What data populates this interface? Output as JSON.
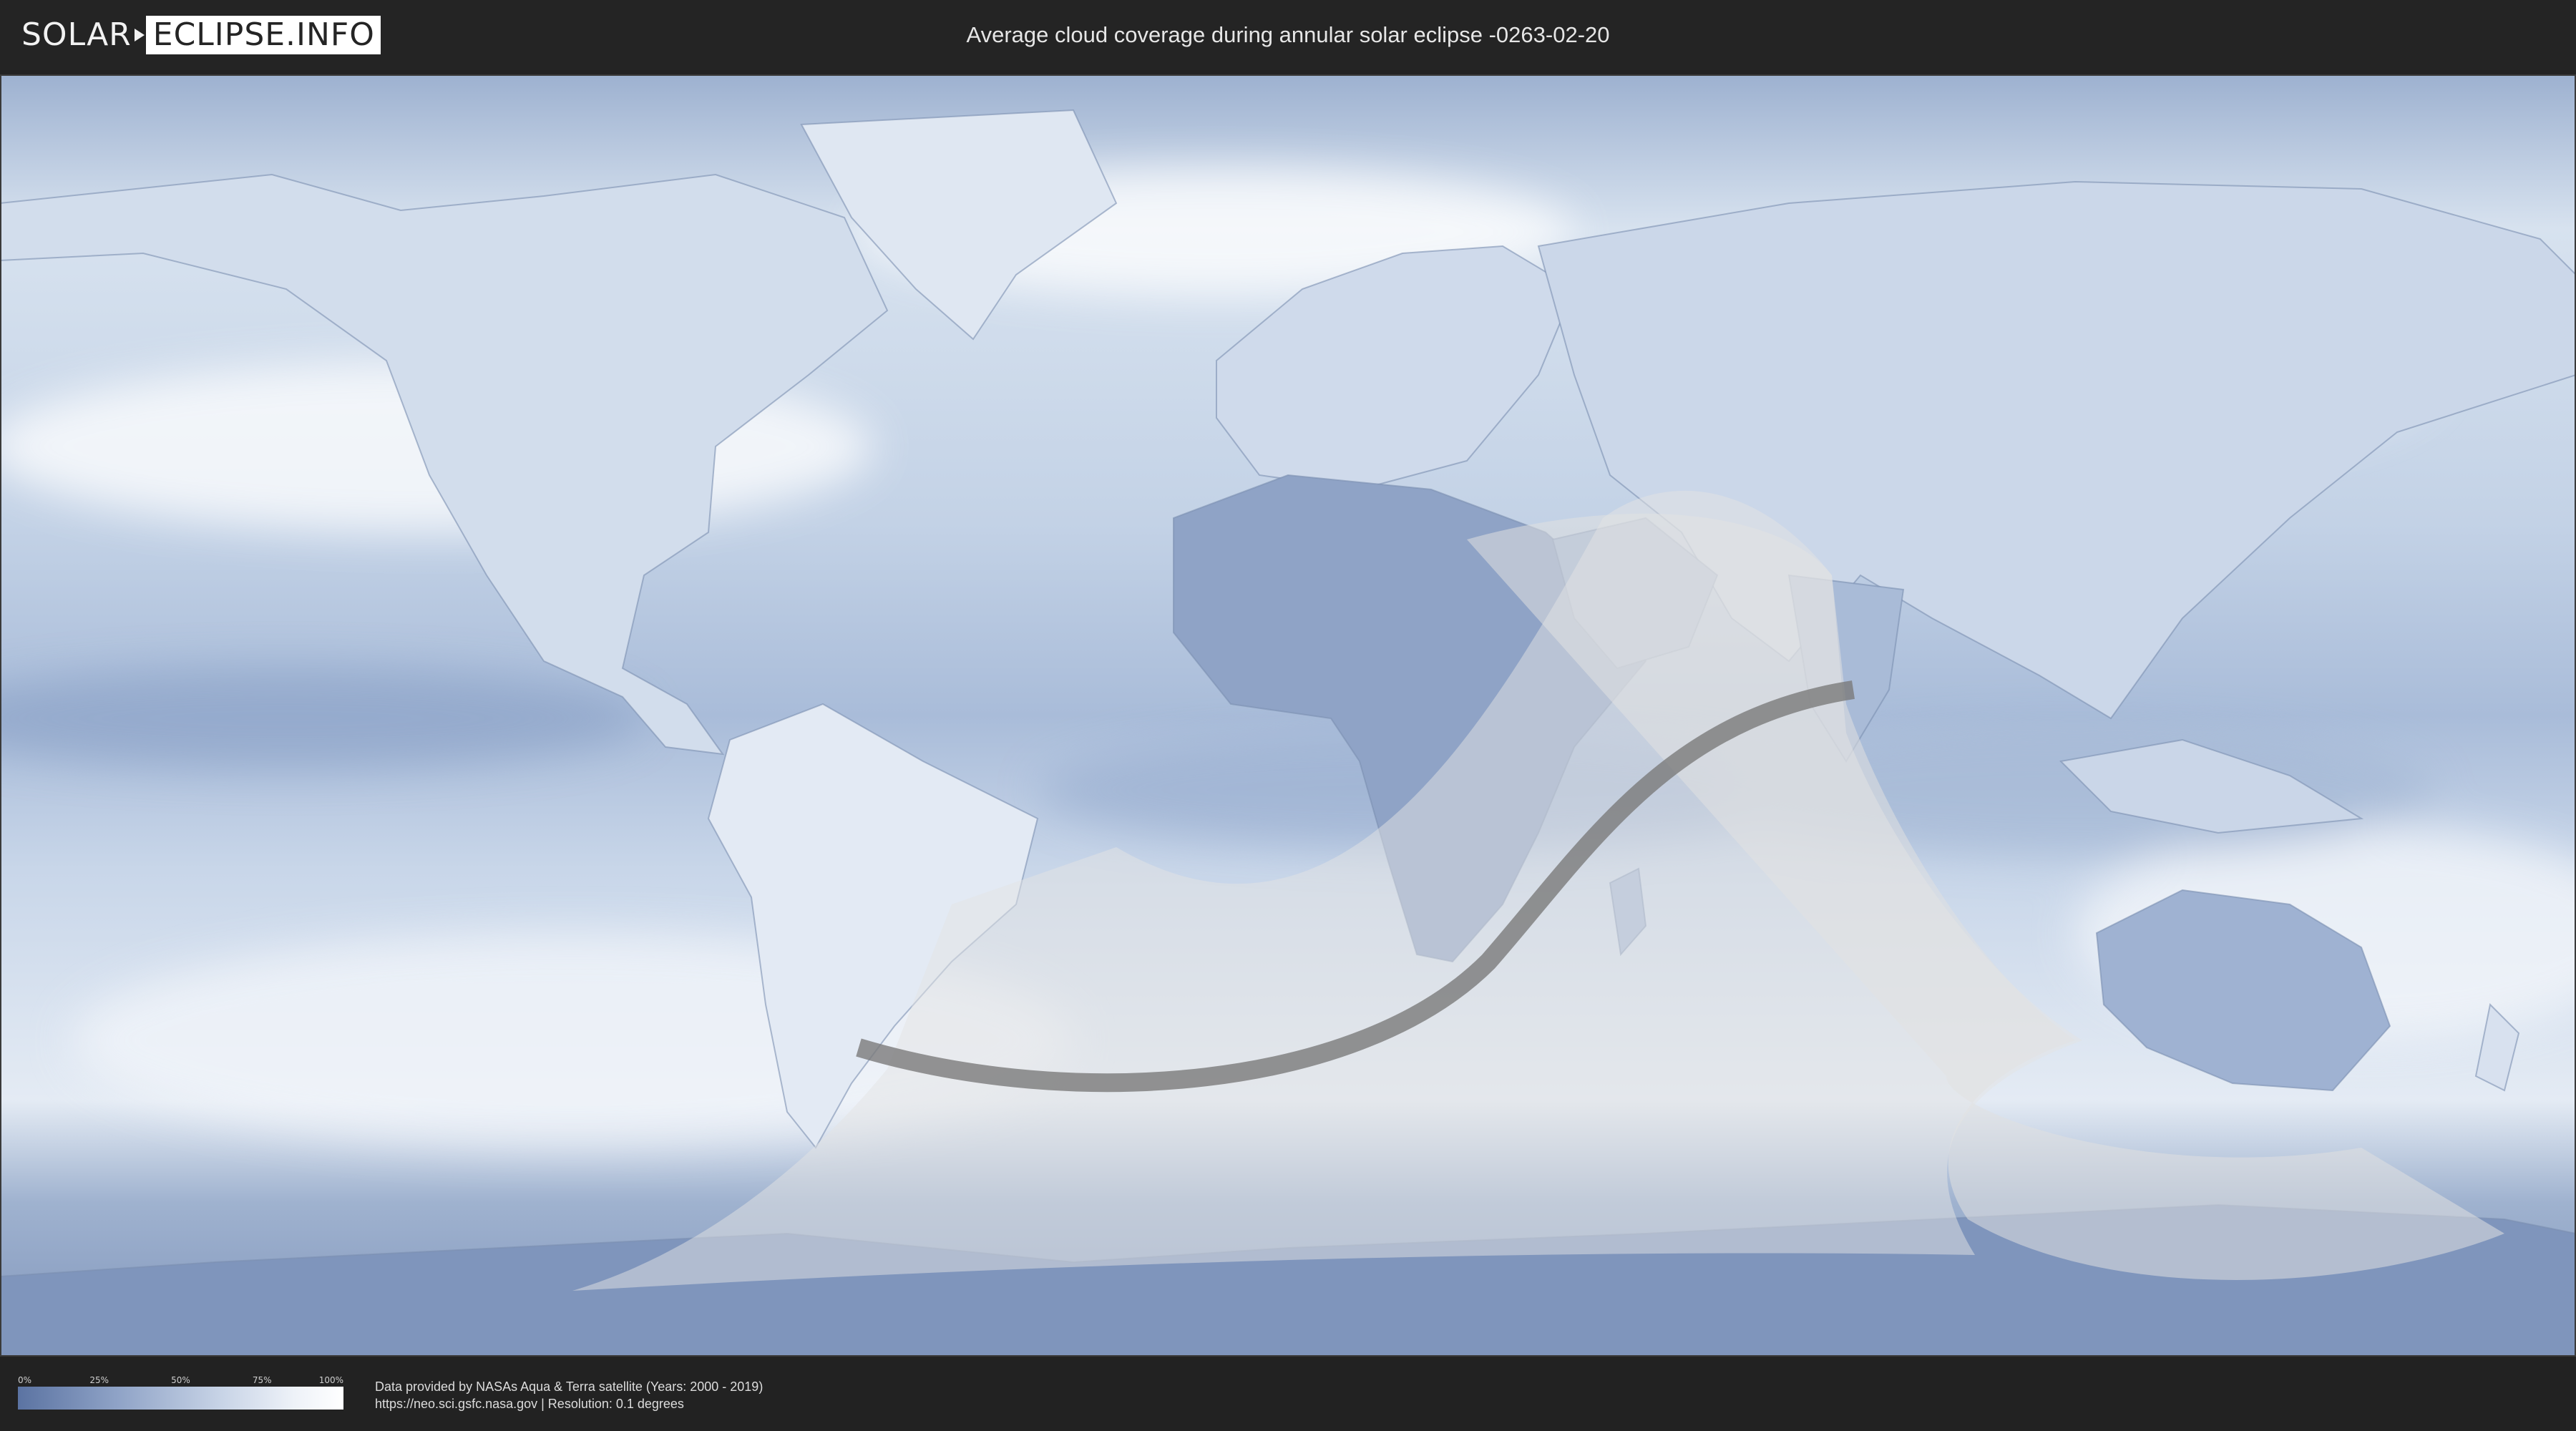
{
  "header": {
    "logo_left": "SOLAR",
    "logo_right": "ECLIPSE.INFO",
    "title": "Average cloud coverage during annular solar eclipse -0263-02-20"
  },
  "legend": {
    "ticks": [
      "0%",
      "25%",
      "50%",
      "75%",
      "100%"
    ],
    "gradient_colors": [
      "#5b73a2",
      "#8ea2c6",
      "#c7d3e6",
      "#eef2f8",
      "#ffffff"
    ]
  },
  "credits": {
    "line1": "Data provided by NASAs Aqua & Terra satellite (Years: 2000 - 2019)",
    "line2": "https://neo.sci.gsfc.nasa.gov | Resolution: 0.1 degrees"
  },
  "colors": {
    "ocean_cloud": "#b9c9e0",
    "clear_sky": "#6f86b2",
    "eclipse_shadow": "#dedede",
    "central_path": "#7a7a7a"
  }
}
